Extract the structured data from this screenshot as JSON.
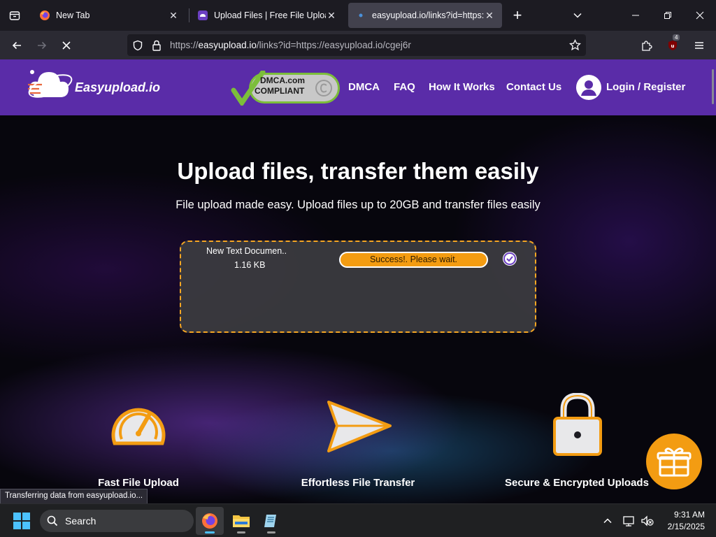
{
  "browser": {
    "tabs": [
      {
        "title": "New Tab",
        "icon": "firefox-icon"
      },
      {
        "title": "Upload Files | Free File Upload a",
        "icon": "easyupload-favicon"
      },
      {
        "title": "easyupload.io/links?id=https://",
        "icon": "loading-dot-icon"
      }
    ],
    "url": {
      "prefix": "https://",
      "domain": "easyupload.io",
      "path": "/links?id=https://easyupload.io/cgej6r"
    },
    "extension_badge": "4",
    "status_text": "Transferring data from easyupload.io..."
  },
  "site": {
    "logo_text": "Easyupload.io",
    "dmca": {
      "line1": "DMCA.com",
      "line2": "COMPLIANT"
    },
    "nav": [
      "DMCA",
      "FAQ",
      "How It Works",
      "Contact Us"
    ],
    "login_label": "Login / Register",
    "hero_title": "Upload files, transfer them easily",
    "hero_subtitle": "File upload made easy. Upload files up to 20GB and transfer files easily",
    "upload": {
      "file_name": "New Text Documen..",
      "file_size": "1.16 KB",
      "status": "Success!. Please wait."
    },
    "features": [
      "Fast File Upload",
      "Effortless File Transfer",
      "Secure & Encrypted Uploads"
    ]
  },
  "taskbar": {
    "search_label": "Search",
    "time": "9:31 AM",
    "date": "2/15/2025"
  },
  "colors": {
    "header_purple": "#5a2ca8",
    "accent_orange": "#f39c12",
    "upload_border": "#f5a623"
  }
}
